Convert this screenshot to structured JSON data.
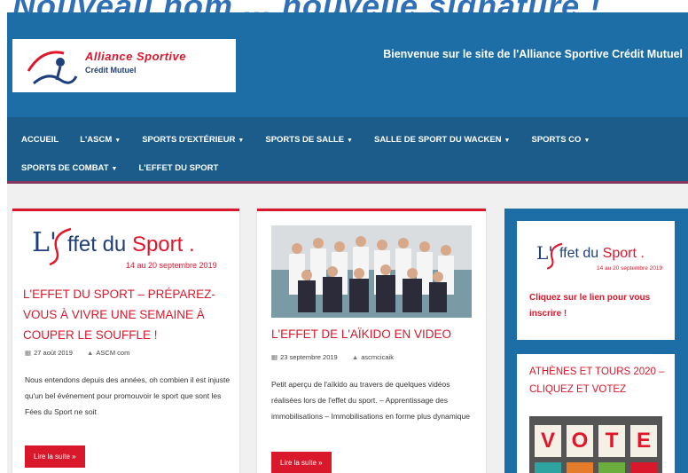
{
  "banner": {
    "text": "Nouveau nom ... nouvelle signature !"
  },
  "header": {
    "logo_line1": "Alliance Sportive",
    "logo_line2": "Crédit Mutuel",
    "welcome": "Bienvenue sur le site de l'Alliance Sportive Crédit Mutuel"
  },
  "nav": {
    "items": [
      {
        "label": "ACCUEIL",
        "dropdown": false
      },
      {
        "label": "L'ASCM",
        "dropdown": true
      },
      {
        "label": "SPORTS D'EXTÉRIEUR",
        "dropdown": true
      },
      {
        "label": "SPORTS DE SALLE",
        "dropdown": true
      },
      {
        "label": "SALLE DE SPORT DU WACKEN",
        "dropdown": true
      },
      {
        "label": "SPORTS CO",
        "dropdown": true
      },
      {
        "label": "SPORTS DE COMBAT",
        "dropdown": true
      },
      {
        "label": "L'EFFET DU SPORT",
        "dropdown": false
      }
    ]
  },
  "effet_logo": {
    "L": "L'",
    "word": "ffet du ",
    "sport": "Sport",
    "dot": " .",
    "date": "14 au 20 septembre 2019"
  },
  "posts": [
    {
      "title": "L'EFFET DU SPORT – PRÉPAREZ-VOUS À VIVRE UNE SEMAINE À COUPER LE SOUFFLE !",
      "date": "27 août 2019",
      "author": "ASCM com",
      "excerpt": "Nous entendons depuis des années, oh combien il est injuste qu'un bel événement pour promouvoir le sport que sont les Fées du Sport ne soit",
      "more": "Lire la suite »"
    },
    {
      "title": "L'EFFET DE L'AÏKIDO EN VIDEO",
      "date": "23 septembre 2019",
      "author": "ascmcicaik",
      "excerpt": "Petit aperçu de l'aïkido au travers de quelques vidéos réalisées lors de l'effet du sport. – Apprentissage des immobilisations – Immobilisations en forme plus dynamique",
      "more": "Lire la suite »"
    }
  ],
  "sidebar": {
    "widget1_link": "Cliquez sur le lien pour vous inscrire !",
    "widget2_title": "ATHÈNES ET TOURS 2020 – CLIQUEZ ET VOTEZ",
    "vote_letters": [
      "V",
      "O",
      "T",
      "E"
    ]
  },
  "colors": {
    "brand_blue": "#1d6ea6",
    "nav_blue": "#1b5c8a",
    "accent_red": "#d9182b"
  }
}
